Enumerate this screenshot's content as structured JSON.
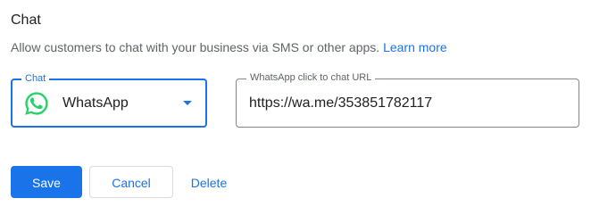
{
  "section": {
    "title": "Chat",
    "description": "Allow customers to chat with your business via SMS or other apps.",
    "learn_more": "Learn more"
  },
  "chat_select": {
    "label": "Chat",
    "value": "WhatsApp",
    "icon": "whatsapp-icon"
  },
  "url_field": {
    "label": "WhatsApp click to chat URL",
    "value": "https://wa.me/353851782117"
  },
  "actions": {
    "save": "Save",
    "cancel": "Cancel",
    "delete": "Delete"
  },
  "colors": {
    "accent": "#1a73e8",
    "whatsapp": "#25d366"
  }
}
